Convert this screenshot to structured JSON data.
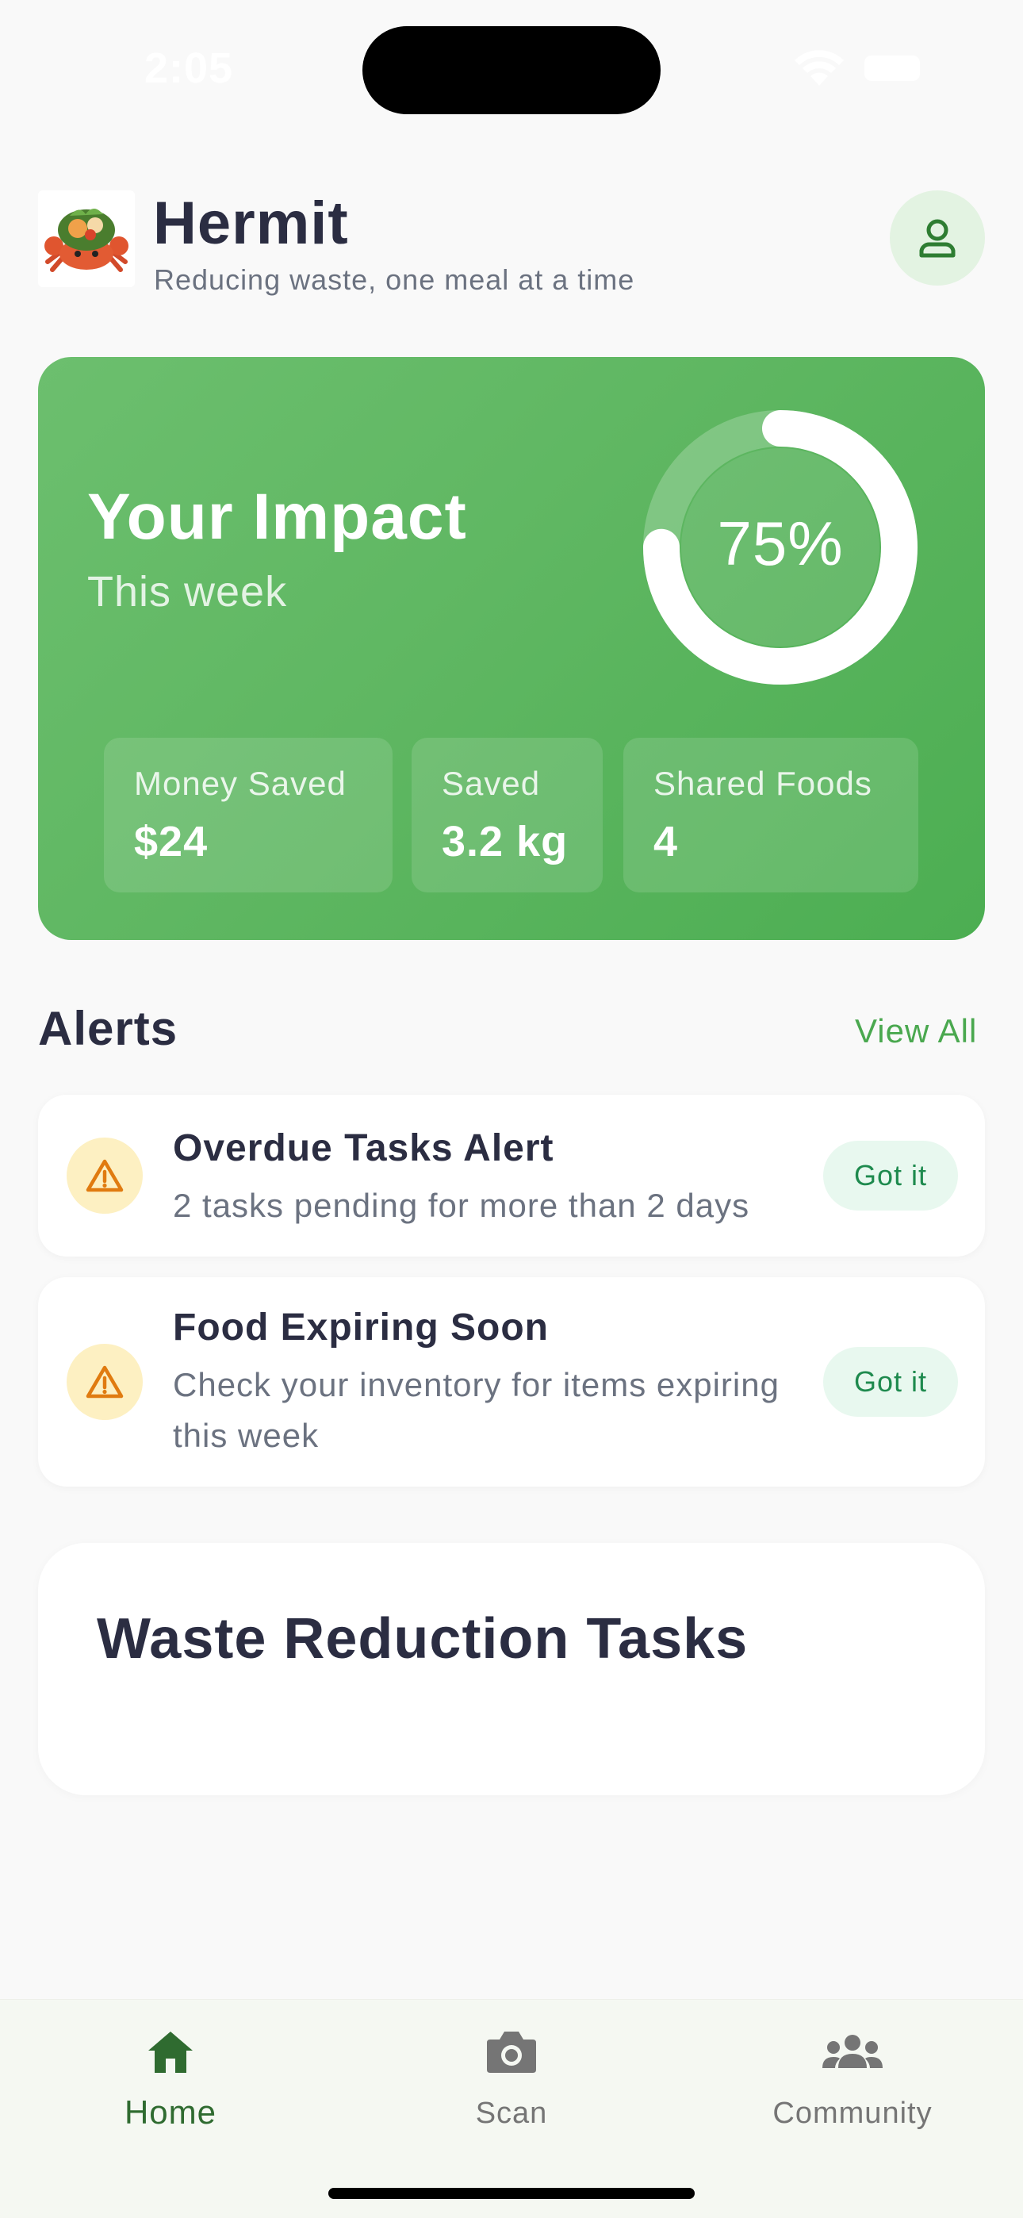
{
  "status_bar": {
    "time": "2:05"
  },
  "header": {
    "title": "Hermit",
    "subtitle": "Reducing waste, one meal at a time"
  },
  "impact": {
    "title": "Your Impact",
    "period": "This week",
    "progress_text": "75%",
    "progress_fraction": 0.75,
    "stats": [
      {
        "label": "Money Saved",
        "value": "$24"
      },
      {
        "label": "Saved",
        "value": "3.2 kg"
      },
      {
        "label": "Shared Foods",
        "value": "4"
      }
    ]
  },
  "alerts": {
    "heading": "Alerts",
    "view_all": "View All",
    "items": [
      {
        "title": "Overdue Tasks Alert",
        "description": "2 tasks pending for more than 2 days",
        "button": "Got it"
      },
      {
        "title": "Food Expiring Soon",
        "description": "Check your inventory for items expiring this week",
        "button": "Got it"
      }
    ]
  },
  "tasks": {
    "title": "Waste Reduction Tasks"
  },
  "nav": {
    "items": [
      {
        "label": "Home",
        "icon": "home-icon",
        "active": true
      },
      {
        "label": "Scan",
        "icon": "camera-icon",
        "active": false
      },
      {
        "label": "Community",
        "icon": "people-icon",
        "active": false
      }
    ]
  },
  "colors": {
    "brand_green": "#5fb762",
    "accent_green": "#4aa84f",
    "warning_orange": "#e07b10",
    "text_dark": "#2b2d42"
  }
}
